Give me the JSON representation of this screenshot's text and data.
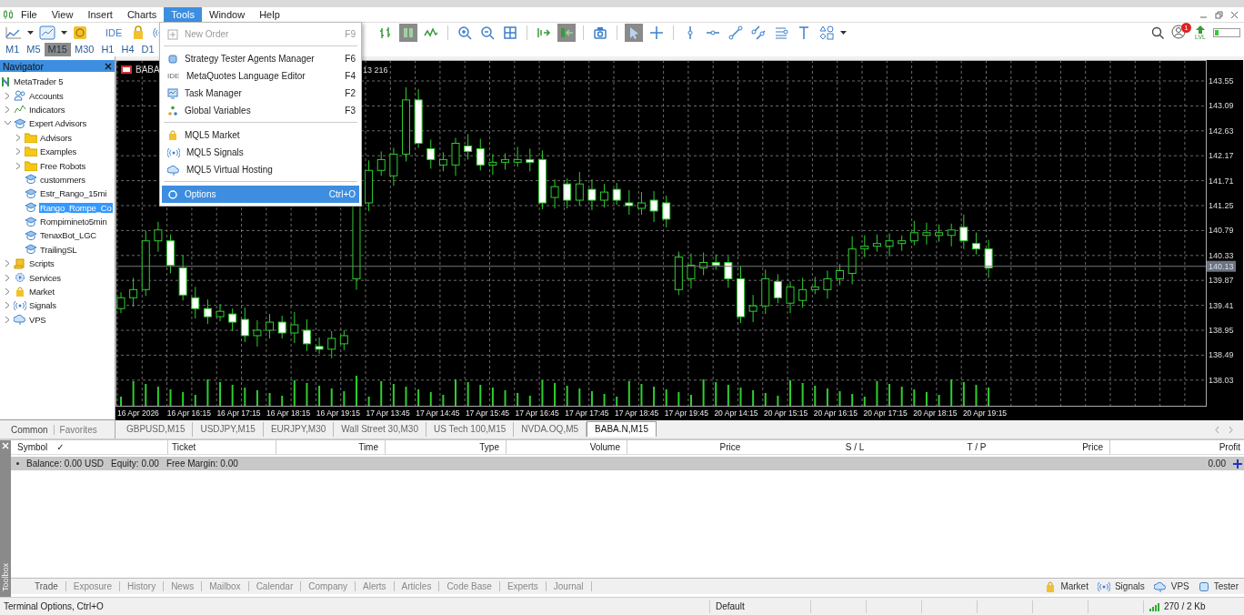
{
  "menu_bar": [
    {
      "label": "File",
      "selected": false
    },
    {
      "label": "View",
      "selected": false
    },
    {
      "label": "Insert",
      "selected": false
    },
    {
      "label": "Charts",
      "selected": false
    },
    {
      "label": "Tools",
      "selected": true
    },
    {
      "label": "Window",
      "selected": false
    },
    {
      "label": "Help",
      "selected": false
    }
  ],
  "toolbar": {
    "ide_label": "IDE",
    "notification_count": "1",
    "level_label": "LVL",
    "chart_buttons": [
      {
        "selected": false
      },
      {
        "selected": true
      },
      {
        "selected": false
      },
      {
        "selected": false
      },
      {
        "selected": false
      },
      {
        "selected": false
      },
      {
        "selected": false
      },
      {
        "selected": true
      },
      {
        "selected": false
      },
      {
        "selected": true
      },
      {
        "selected": false
      },
      {
        "selected": false
      },
      {
        "selected": false
      },
      {
        "selected": false
      },
      {
        "selected": false
      },
      {
        "selected": false
      },
      {
        "selected": false
      },
      {
        "selected": false
      }
    ]
  },
  "timeframes": [
    {
      "label": "M1",
      "selected": false
    },
    {
      "label": "M5",
      "selected": false
    },
    {
      "label": "M15",
      "selected": true
    },
    {
      "label": "M30",
      "selected": false
    },
    {
      "label": "H1",
      "selected": false
    },
    {
      "label": "H4",
      "selected": false
    },
    {
      "label": "D1",
      "selected": false
    }
  ],
  "tools_menu": [
    {
      "kind": "item",
      "label": "New Order",
      "shortcut": "F9",
      "disabled": true,
      "selected": false
    },
    {
      "kind": "separator"
    },
    {
      "kind": "item",
      "label": "Strategy Tester Agents Manager",
      "shortcut": "F6",
      "disabled": false,
      "selected": false
    },
    {
      "kind": "item",
      "label": "MetaQuotes Language Editor",
      "shortcut": "F4",
      "badge": "IDE",
      "disabled": false,
      "selected": false
    },
    {
      "kind": "item",
      "label": "Task Manager",
      "shortcut": "F2",
      "disabled": false,
      "selected": false
    },
    {
      "kind": "item",
      "label": "Global Variables",
      "shortcut": "F3",
      "disabled": false,
      "selected": false
    },
    {
      "kind": "separator"
    },
    {
      "kind": "item",
      "label": "MQL5 Market",
      "disabled": false,
      "selected": false
    },
    {
      "kind": "item",
      "label": "MQL5 Signals",
      "disabled": false,
      "selected": false
    },
    {
      "kind": "item",
      "label": "MQL5 Virtual Hosting",
      "disabled": false,
      "selected": false
    },
    {
      "kind": "separator"
    },
    {
      "kind": "item",
      "label": "Options",
      "shortcut": "Ctrl+O",
      "disabled": false,
      "selected": true
    }
  ],
  "navigator": {
    "title": "Navigator",
    "tree": [
      {
        "kind": "root",
        "label": "MetaTrader 5",
        "selected": false,
        "children": [
          {
            "kind": "group",
            "label": "Accounts",
            "selected": false,
            "expanded": false
          },
          {
            "kind": "group",
            "label": "Indicators",
            "selected": false,
            "expanded": false
          },
          {
            "kind": "group",
            "label": "Expert Advisors",
            "selected": false,
            "expanded": true,
            "children": [
              {
                "kind": "folder",
                "label": "Advisors",
                "selected": false,
                "expanded": false
              },
              {
                "kind": "folder",
                "label": "Examples",
                "selected": false,
                "expanded": false
              },
              {
                "kind": "folder",
                "label": "Free Robots",
                "selected": false,
                "expanded": false
              },
              {
                "kind": "expert",
                "label": "custommers",
                "selected": false
              },
              {
                "kind": "expert",
                "label": "Estr_Rango_15mi",
                "selected": false
              },
              {
                "kind": "expert",
                "label": "Rango_Rompe_Co",
                "selected": true
              },
              {
                "kind": "expert",
                "label": "Rompimineto5min",
                "selected": false
              },
              {
                "kind": "expert",
                "label": "TenaxBot_LGC",
                "selected": false
              },
              {
                "kind": "expert",
                "label": "TrailingSL",
                "selected": false
              }
            ]
          },
          {
            "kind": "group",
            "label": "Scripts",
            "selected": false,
            "expanded": false
          },
          {
            "kind": "group",
            "label": "Services",
            "selected": false,
            "expanded": false
          },
          {
            "kind": "group",
            "label": "Market",
            "selected": false,
            "expanded": false
          },
          {
            "kind": "group",
            "label": "Signals",
            "selected": false,
            "expanded": false
          },
          {
            "kind": "group",
            "label": "VPS",
            "selected": false,
            "expanded": false
          }
        ]
      }
    ],
    "tabs": [
      {
        "label": "Common",
        "selected": true
      },
      {
        "label": "Favorites",
        "selected": false
      }
    ]
  },
  "chart": {
    "title": "BABA",
    "title_fragment": "13 216",
    "current_price": "140.13",
    "price_labels": [
      "143.55",
      "143.09",
      "142.63",
      "142.17",
      "141.71",
      "141.25",
      "140.79",
      "140.33",
      "139.87",
      "139.41",
      "138.95",
      "138.49",
      "138.03"
    ],
    "time_labels": [
      "16 Apr 2026",
      "16 Apr 16:15",
      "16 Apr 17:15",
      "16 Apr 18:15",
      "16 Apr 19:15",
      "17 Apr 13:45",
      "17 Apr 14:45",
      "17 Apr 15:45",
      "17 Apr 16:45",
      "17 Apr 17:45",
      "17 Apr 18:45",
      "17 Apr 19:45",
      "20 Apr 14:15",
      "20 Apr 15:15",
      "20 Apr 16:15",
      "20 Apr 17:15",
      "20 Apr 18:15",
      "20 Apr 19:15"
    ]
  },
  "chart_tabs": [
    {
      "label": "GBPUSD,M15",
      "selected": false
    },
    {
      "label": "USDJPY,M15",
      "selected": false
    },
    {
      "label": "EURJPY,M30",
      "selected": false
    },
    {
      "label": "Wall Street 30,M30",
      "selected": false
    },
    {
      "label": "US Tech 100,M15",
      "selected": false
    },
    {
      "label": "NVDA.OQ,M5",
      "selected": false
    },
    {
      "label": "BABA.N,M15",
      "selected": true
    }
  ],
  "toolbox": {
    "title": "Toolbox",
    "sort_mark": "✓",
    "columns": [
      "Symbol",
      "Ticket",
      "Time",
      "Type",
      "Volume",
      "Price",
      "S / L",
      "T / P",
      "Price",
      "Profit"
    ],
    "summary": [
      "Balance: 0.00 USD",
      "Equity: 0.00",
      "Free Margin: 0.00"
    ],
    "profit": "0.00",
    "tabs": [
      {
        "label": "Trade",
        "selected": true
      },
      {
        "label": "Exposure",
        "selected": false
      },
      {
        "label": "History",
        "selected": false
      },
      {
        "label": "News",
        "selected": false
      },
      {
        "label": "Mailbox",
        "selected": false
      },
      {
        "label": "Calendar",
        "selected": false
      },
      {
        "label": "Company",
        "selected": false
      },
      {
        "label": "Alerts",
        "selected": false
      },
      {
        "label": "Articles",
        "selected": false
      },
      {
        "label": "Code Base",
        "selected": false
      },
      {
        "label": "Experts",
        "selected": false
      },
      {
        "label": "Journal",
        "selected": false
      }
    ],
    "links": [
      "Market",
      "Signals",
      "VPS",
      "Tester"
    ]
  },
  "status_bar": {
    "hint": "Terminal Options, Ctrl+O",
    "profile": "Default",
    "traffic": "270 / 2 Kb"
  }
}
